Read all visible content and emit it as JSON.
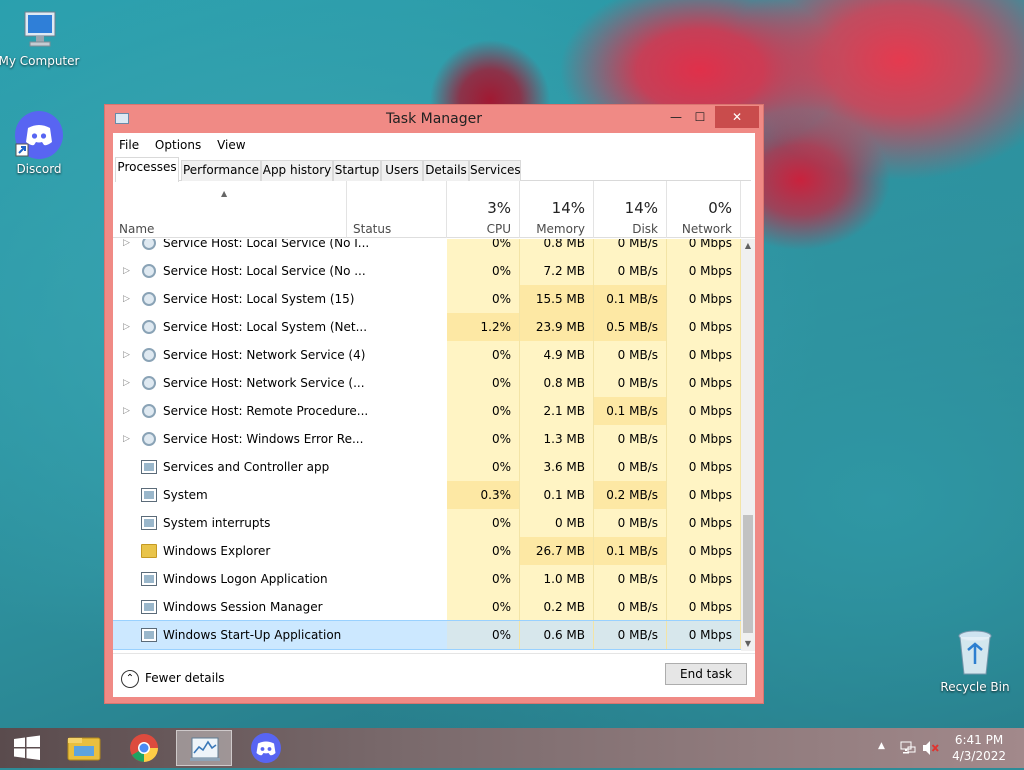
{
  "desktop": {
    "icons": [
      {
        "label": "My Computer",
        "icon": "computer-icon"
      },
      {
        "label": "Discord",
        "icon": "discord-icon"
      },
      {
        "label": "Recycle Bin",
        "icon": "recycle-bin-icon"
      }
    ]
  },
  "window": {
    "title": "Task Manager",
    "controls": {
      "minimize": "—",
      "maximize": "☐",
      "close": "✕"
    },
    "menu": [
      "File",
      "Options",
      "View"
    ],
    "tabs": [
      "Processes",
      "Performance",
      "App history",
      "Startup",
      "Users",
      "Details",
      "Services"
    ],
    "active_tab": "Processes",
    "columns": {
      "name": "Name",
      "status": "Status",
      "cpu": {
        "label": "CPU",
        "pct": "3%"
      },
      "memory": {
        "label": "Memory",
        "pct": "14%"
      },
      "disk": {
        "label": "Disk",
        "pct": "14%"
      },
      "network": {
        "label": "Network",
        "pct": "0%"
      }
    },
    "rows": [
      {
        "name": "Service Host: Local Service (No I...",
        "cpu": "0%",
        "mem": "0.8 MB",
        "disk": "0 MB/s",
        "net": "0 Mbps",
        "icon": "gear",
        "expand": true
      },
      {
        "name": "Service Host: Local Service (No ...",
        "cpu": "0%",
        "mem": "7.2 MB",
        "disk": "0 MB/s",
        "net": "0 Mbps",
        "icon": "gear",
        "expand": true
      },
      {
        "name": "Service Host: Local System (15)",
        "cpu": "0%",
        "mem": "15.5 MB",
        "disk": "0.1 MB/s",
        "net": "0 Mbps",
        "icon": "gear",
        "expand": true
      },
      {
        "name": "Service Host: Local System (Net...",
        "cpu": "1.2%",
        "mem": "23.9 MB",
        "disk": "0.5 MB/s",
        "net": "0 Mbps",
        "icon": "gear",
        "expand": true
      },
      {
        "name": "Service Host: Network Service (4)",
        "cpu": "0%",
        "mem": "4.9 MB",
        "disk": "0 MB/s",
        "net": "0 Mbps",
        "icon": "gear",
        "expand": true
      },
      {
        "name": "Service Host: Network Service (...",
        "cpu": "0%",
        "mem": "0.8 MB",
        "disk": "0 MB/s",
        "net": "0 Mbps",
        "icon": "gear",
        "expand": true
      },
      {
        "name": "Service Host: Remote Procedure...",
        "cpu": "0%",
        "mem": "2.1 MB",
        "disk": "0.1 MB/s",
        "net": "0 Mbps",
        "icon": "gear",
        "expand": true
      },
      {
        "name": "Service Host: Windows Error Re...",
        "cpu": "0%",
        "mem": "1.3 MB",
        "disk": "0 MB/s",
        "net": "0 Mbps",
        "icon": "gear",
        "expand": true
      },
      {
        "name": "Services and Controller app",
        "cpu": "0%",
        "mem": "3.6 MB",
        "disk": "0 MB/s",
        "net": "0 Mbps",
        "icon": "win",
        "expand": false
      },
      {
        "name": "System",
        "cpu": "0.3%",
        "mem": "0.1 MB",
        "disk": "0.2 MB/s",
        "net": "0 Mbps",
        "icon": "win",
        "expand": false
      },
      {
        "name": "System interrupts",
        "cpu": "0%",
        "mem": "0 MB",
        "disk": "0 MB/s",
        "net": "0 Mbps",
        "icon": "win",
        "expand": false
      },
      {
        "name": "Windows Explorer",
        "cpu": "0%",
        "mem": "26.7 MB",
        "disk": "0.1 MB/s",
        "net": "0 Mbps",
        "icon": "folder",
        "expand": false
      },
      {
        "name": "Windows Logon Application",
        "cpu": "0%",
        "mem": "1.0 MB",
        "disk": "0 MB/s",
        "net": "0 Mbps",
        "icon": "win",
        "expand": false
      },
      {
        "name": "Windows Session Manager",
        "cpu": "0%",
        "mem": "0.2 MB",
        "disk": "0 MB/s",
        "net": "0 Mbps",
        "icon": "win",
        "expand": false
      },
      {
        "name": "Windows Start-Up Application",
        "cpu": "0%",
        "mem": "0.6 MB",
        "disk": "0 MB/s",
        "net": "0 Mbps",
        "icon": "win",
        "expand": false,
        "selected": true
      }
    ],
    "footer": {
      "fewer_details": "Fewer details",
      "end_task": "End task"
    }
  },
  "taskbar": {
    "items": [
      "start-icon",
      "file-explorer-icon",
      "chrome-icon",
      "task-manager-icon",
      "discord-icon"
    ],
    "active": "task-manager-icon",
    "clock": {
      "time": "6:41 PM",
      "date": "4/3/2022"
    }
  },
  "colors": {
    "window_border": "#f08a85",
    "heat_cell": "#fff4c4",
    "selection": "#cce8ff",
    "close_button": "#c94c4c"
  }
}
